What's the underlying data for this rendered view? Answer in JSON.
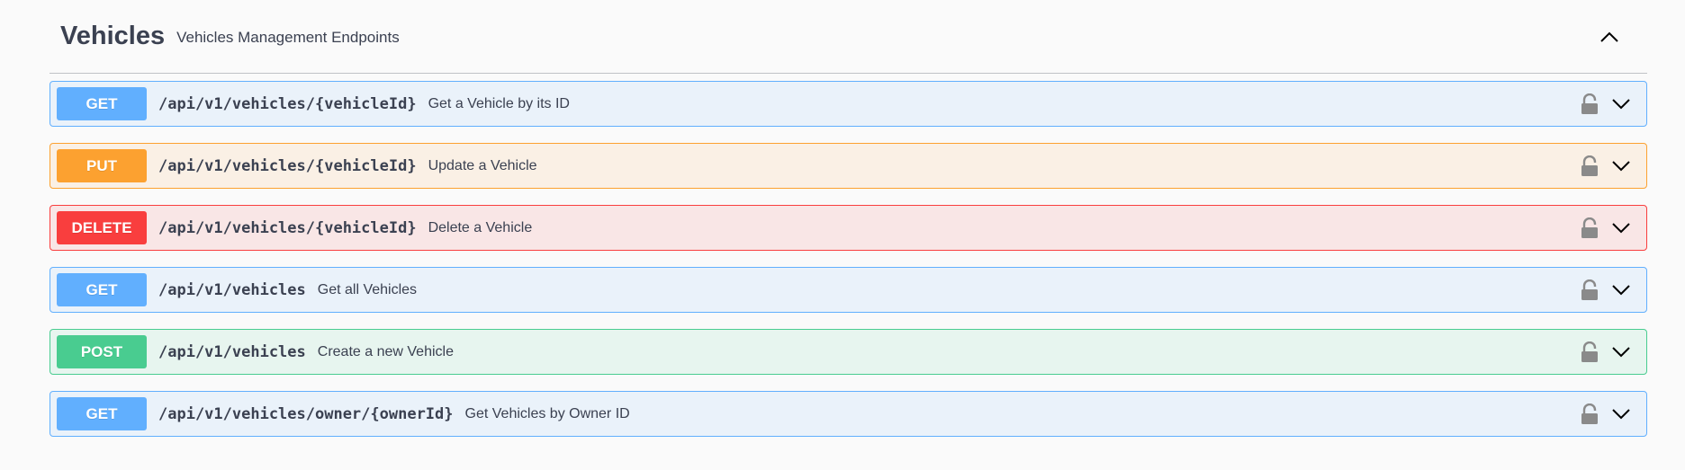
{
  "tag": {
    "title": "Vehicles",
    "description": "Vehicles Management Endpoints",
    "expanded": true
  },
  "operations": [
    {
      "method": "GET",
      "path": "/api/v1/vehicles/{vehicleId}",
      "summary": "Get a Vehicle by its ID"
    },
    {
      "method": "PUT",
      "path": "/api/v1/vehicles/{vehicleId}",
      "summary": "Update a Vehicle"
    },
    {
      "method": "DELETE",
      "path": "/api/v1/vehicles/{vehicleId}",
      "summary": "Delete a Vehicle"
    },
    {
      "method": "GET",
      "path": "/api/v1/vehicles",
      "summary": "Get all Vehicles"
    },
    {
      "method": "POST",
      "path": "/api/v1/vehicles",
      "summary": "Create a new Vehicle"
    },
    {
      "method": "GET",
      "path": "/api/v1/vehicles/owner/{ownerId}",
      "summary": "Get Vehicles by Owner ID"
    }
  ],
  "icons": {
    "collapse": "chevron-up-icon",
    "lock": "lock-open-icon",
    "expand": "chevron-down-icon"
  },
  "colors": {
    "GET": "#61affe",
    "PUT": "#fca130",
    "DELETE": "#f93e3e",
    "POST": "#49cc90"
  }
}
